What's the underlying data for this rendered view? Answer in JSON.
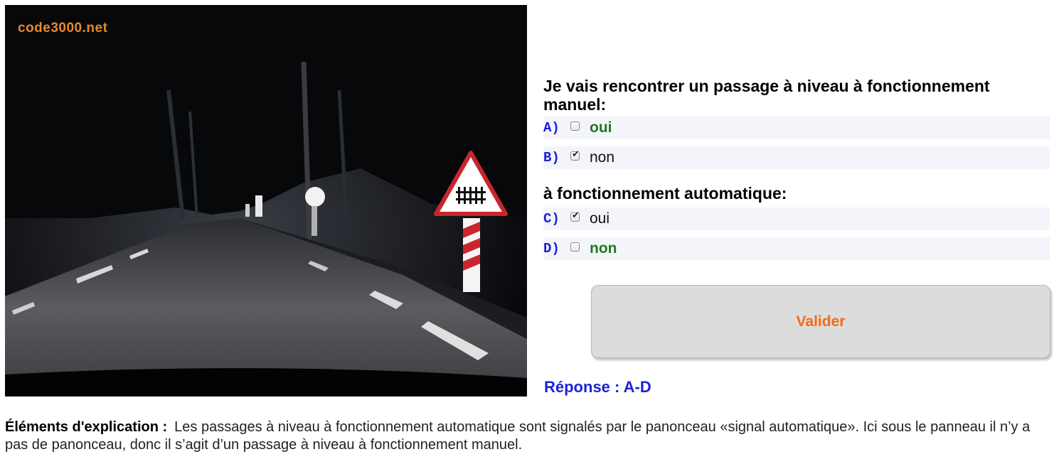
{
  "image": {
    "watermark": "code3000.net",
    "description_icon": "railway-crossing-sign"
  },
  "question1": "Je vais rencontrer un passage à niveau à fonctionnement manuel:",
  "question2": "à fonctionnement automatique:",
  "options": [
    {
      "letter": "A)",
      "text": "oui",
      "checked": false
    },
    {
      "letter": "B)",
      "text": "non",
      "checked": true
    },
    {
      "letter": "C)",
      "text": "oui",
      "checked": true
    },
    {
      "letter": "D)",
      "text": "non",
      "checked": false
    }
  ],
  "validate_label": "Valider",
  "answer": "Réponse : A-D",
  "explanation": {
    "label": "Éléments d'explication :",
    "text": "Les passages à niveau à fonctionnement automatique sont signalés par le panonceau «signal automatique». Ici sous le panneau il n’y a pas de panonceau, donc il s’agit d’un passage à niveau à fonctionnement manuel."
  },
  "colors": {
    "letter": "#1a22d9",
    "correct": "#1f7a1f",
    "button_text": "#f06b1b",
    "answer": "#1a22d9",
    "watermark": "#e58a2c"
  }
}
